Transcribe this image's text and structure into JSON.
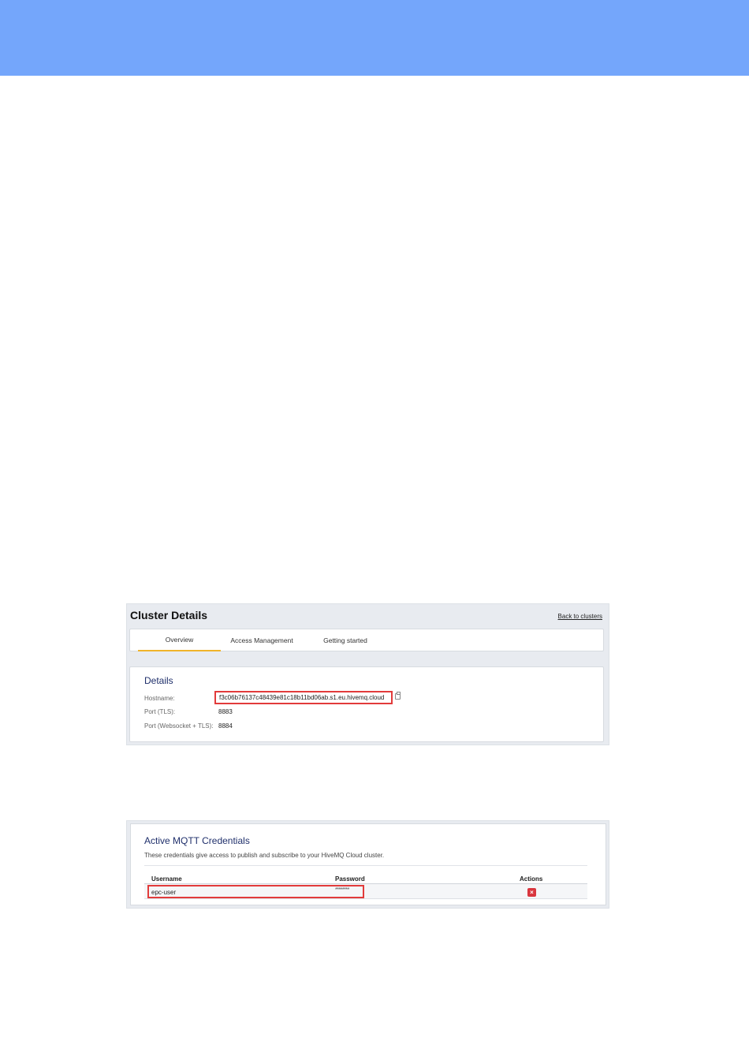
{
  "cluster": {
    "title": "Cluster Details",
    "back_link": "Back to clusters",
    "tabs": [
      "Overview",
      "Access Management",
      "Getting started"
    ],
    "active_tab": "Overview",
    "details": {
      "heading": "Details",
      "hostname_label": "Hostname:",
      "hostname_value": "f3c06b76137c48439e81c18b11bd06ab.s1.eu.hivemq.cloud",
      "port_tls_label": "Port (TLS):",
      "port_tls_value": "8883",
      "port_ws_label": "Port (Websocket + TLS):",
      "port_ws_value": "8884"
    }
  },
  "credentials": {
    "title": "Active MQTT Credentials",
    "description": "These credentials give access to publish and subscribe to your HiveMQ Cloud cluster.",
    "columns": [
      "Username",
      "Password",
      "Actions"
    ],
    "rows": [
      {
        "username": "epc-user",
        "password": "********"
      }
    ],
    "delete_glyph": "×"
  },
  "colors": {
    "banner": "#74a6fb",
    "highlight": "#e23b3b",
    "tab_underline": "#f0b429",
    "heading": "#1f2f6b",
    "delete": "#d9363e"
  },
  "icons": [
    "copy-icon",
    "delete-icon"
  ]
}
